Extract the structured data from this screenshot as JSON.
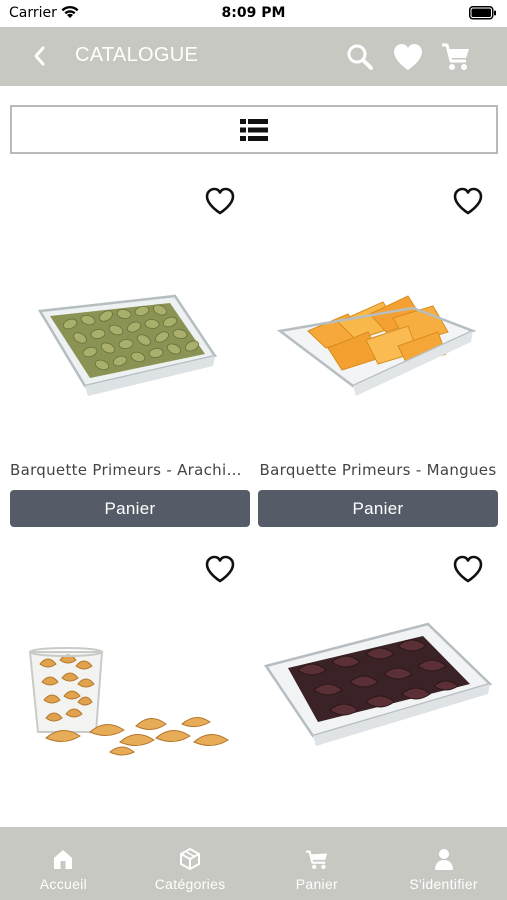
{
  "status_bar": {
    "carrier": "Carrier",
    "time": "8:09 PM"
  },
  "header": {
    "title": "CATALOGUE",
    "back_icon": "chevron-left-icon",
    "search_icon": "search-icon",
    "favorites_icon": "heart-icon",
    "cart_icon": "cart-icon"
  },
  "view_toggle": {
    "icon": "list-view-icon"
  },
  "products": [
    {
      "name": "Barquette Primeurs - Arachides",
      "button_label": "Panier",
      "favorite_icon": "heart-outline-icon",
      "image": "tray-of-green-peanuts"
    },
    {
      "name": "Barquette Primeurs - Mangues",
      "button_label": "Panier",
      "favorite_icon": "heart-outline-icon",
      "image": "tray-of-dried-mango"
    },
    {
      "name": "",
      "button_label": "",
      "favorite_icon": "heart-outline-icon",
      "image": "glass-of-cashews"
    },
    {
      "name": "",
      "button_label": "",
      "favorite_icon": "heart-outline-icon",
      "image": "tray-of-dates"
    }
  ],
  "tab_bar": {
    "items": [
      {
        "label": "Accueil",
        "icon": "home-icon"
      },
      {
        "label": "Catégories",
        "icon": "categories-cube-icon"
      },
      {
        "label": "Panier",
        "icon": "shopping-cart-icon"
      },
      {
        "label": "S'identifier",
        "icon": "user-icon"
      }
    ]
  },
  "colors": {
    "nav_background": "#c8c8c3",
    "button_background": "#565b68",
    "tab_background": "#c8c8c3"
  }
}
